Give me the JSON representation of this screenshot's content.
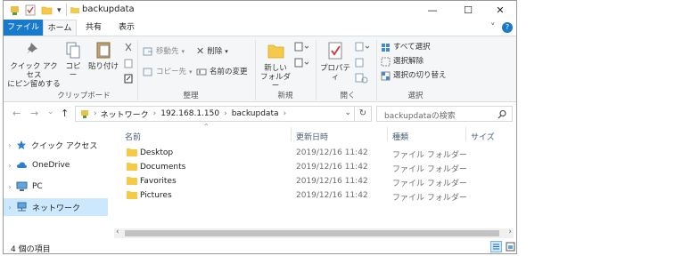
{
  "window": {
    "title": "backupdata",
    "minimize_glyph": "—",
    "maximize_glyph": "☐",
    "close_glyph": "✕",
    "quick_access_dropdown": "▾"
  },
  "tabs": [
    {
      "label": "ファイル"
    },
    {
      "label": "ホーム"
    },
    {
      "label": "共有"
    },
    {
      "label": "表示"
    }
  ],
  "ribbon_help_glyph": "?",
  "ribbon_collapse_glyph": "˅",
  "ribbon": {
    "clipboard": {
      "pin_label_1": "クイック アクセス",
      "pin_label_2": "にピン留めする",
      "copy_label": "コピー",
      "paste_label": "貼り付け",
      "group_label": "クリップボード"
    },
    "organize": {
      "move_to": "移動先",
      "copy_to": "コピー先",
      "delete": "削除",
      "rename": "名前の変更",
      "group_label": "整理"
    },
    "new": {
      "new_folder_1": "新しい",
      "new_folder_2": "フォルダー",
      "group_label": "新規"
    },
    "open": {
      "properties": "プロパティ",
      "group_label": "開く"
    },
    "select": {
      "select_all": "すべて選択",
      "select_none": "選択解除",
      "invert": "選択の切り替え",
      "group_label": "選択"
    }
  },
  "nav": {
    "back": "←",
    "forward": "→",
    "recent": "⌄",
    "up": "↑"
  },
  "address": {
    "segments": [
      "ネットワーク",
      "192.168.1.150",
      "backupdata"
    ],
    "separator": "›",
    "dropdown": "⌄",
    "refresh": "↻"
  },
  "search": {
    "placeholder": "backupdataの検索"
  },
  "sidebar": {
    "items": [
      {
        "label": "クイック アクセス"
      },
      {
        "label": "OneDrive"
      },
      {
        "label": "PC"
      },
      {
        "label": "ネットワーク"
      }
    ]
  },
  "columns": {
    "name": "名前",
    "modified": "更新日時",
    "type": "種類",
    "size": "サイズ"
  },
  "files": [
    {
      "name": "Desktop",
      "modified": "2019/12/16 11:42",
      "type": "ファイル フォルダー"
    },
    {
      "name": "Documents",
      "modified": "2019/12/16 11:42",
      "type": "ファイル フォルダー"
    },
    {
      "name": "Favorites",
      "modified": "2019/12/16 11:42",
      "type": "ファイル フォルダー"
    },
    {
      "name": "Pictures",
      "modified": "2019/12/16 11:42",
      "type": "ファイル フォルダー"
    }
  ],
  "scroll": {
    "left": "‹",
    "right": "›"
  },
  "status": {
    "item_count": "4 個の項目"
  },
  "colors": {
    "accent": "#1979ca",
    "folder": "#f7c948",
    "selection": "#cce8ff"
  }
}
